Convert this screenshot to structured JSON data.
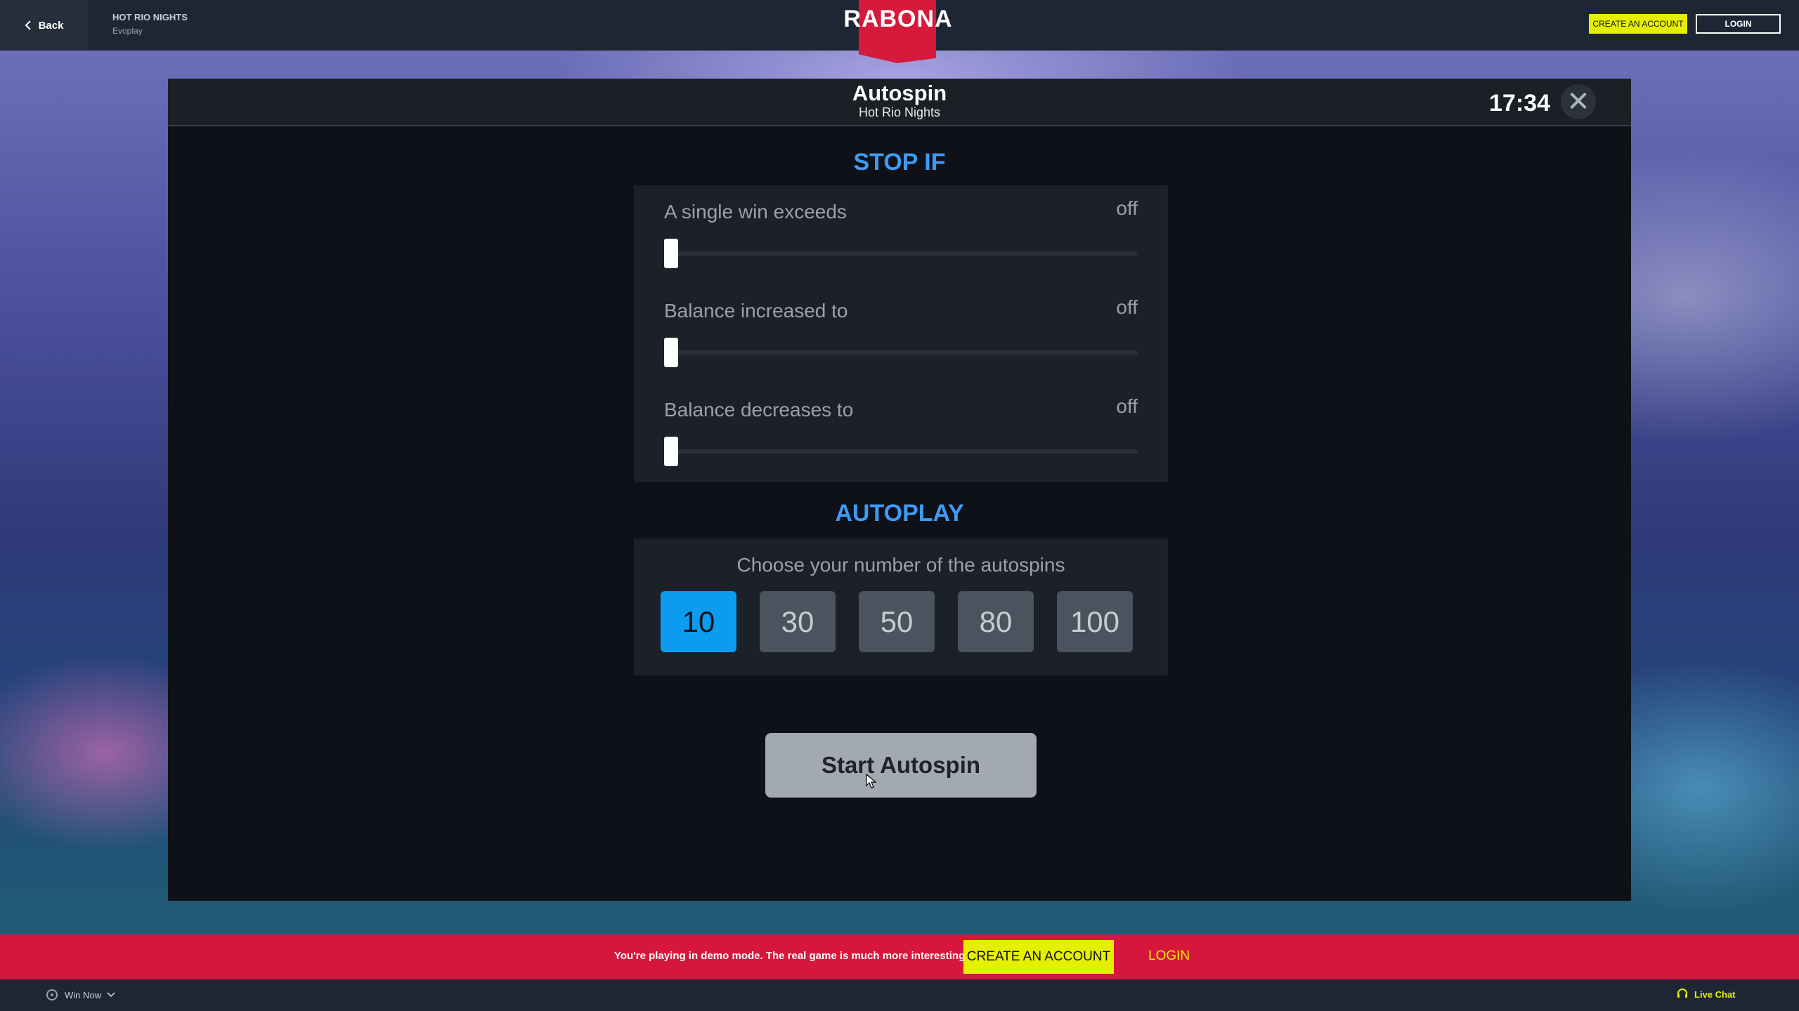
{
  "topbar": {
    "back_label": "Back",
    "game_title": "HOT RIO NIGHTS",
    "game_provider": "Evoplay",
    "logo_text": "RABONA",
    "create_account_label": "CREATE AN ACCOUNT",
    "login_label": "LOGIN"
  },
  "dialog": {
    "title": "Autospin",
    "subtitle": "Hot Rio Nights",
    "clock": "17:34",
    "close_symbol": "✕",
    "stop_if": {
      "heading": "STOP IF",
      "rows": [
        {
          "label": "A single win exceeds",
          "value": "off",
          "level": 0
        },
        {
          "label": "Balance increased to",
          "value": "off",
          "level": 0
        },
        {
          "label": "Balance decreases to",
          "value": "off",
          "level": 0
        }
      ]
    },
    "autoplay": {
      "heading": "AUTOPLAY",
      "prompt": "Choose your number of the autospins",
      "options": [
        "10",
        "30",
        "50",
        "80",
        "100"
      ],
      "selected": "10"
    },
    "start_label": "Start Autospin"
  },
  "demo_banner": {
    "text": "You're playing in demo mode. The real game is much more interesting",
    "create_account_label": "CREATE AN ACCOUNT",
    "login_label": "LOGIN"
  },
  "footer": {
    "win_now_label": "Win Now",
    "live_chat_label": "Live Chat"
  },
  "colors": {
    "accent_blue": "#3e9bf5",
    "selected_option": "#0c9bef",
    "brand_red": "#d61a3c",
    "cta_yellow": "#e5f000"
  }
}
